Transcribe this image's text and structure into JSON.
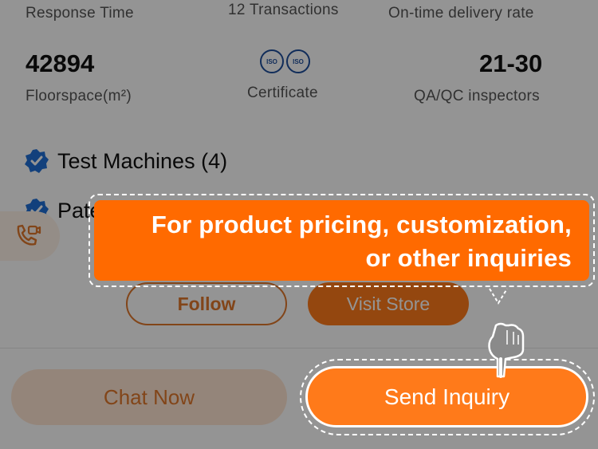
{
  "stats": {
    "row1": {
      "response_time_label": "Response Time",
      "transactions_label": "12 Transactions",
      "ontime_label": "On-time delivery rate"
    },
    "floorspace": {
      "value": "42894",
      "label": "Floorspace(m²)"
    },
    "certificate": {
      "label": "Certificate",
      "badges": [
        "ISO",
        "ISO"
      ]
    },
    "qa": {
      "value": "21-30",
      "label": "QA/QC inspectors"
    }
  },
  "features": {
    "test_machines": "Test Machines (4)",
    "patents_partial": "Pate"
  },
  "actions": {
    "follow": "Follow",
    "visit_store": "Visit Store"
  },
  "bottom_bar": {
    "chat_now": "Chat Now",
    "send_inquiry": "Send Inquiry"
  },
  "tooltip": {
    "line1": "For product pricing, customization,",
    "line2": "or other inquiries"
  },
  "colors": {
    "accent": "#ff7a1a",
    "tooltip_bg": "#ff6a00",
    "verified_badge": "#1f6fd6"
  }
}
